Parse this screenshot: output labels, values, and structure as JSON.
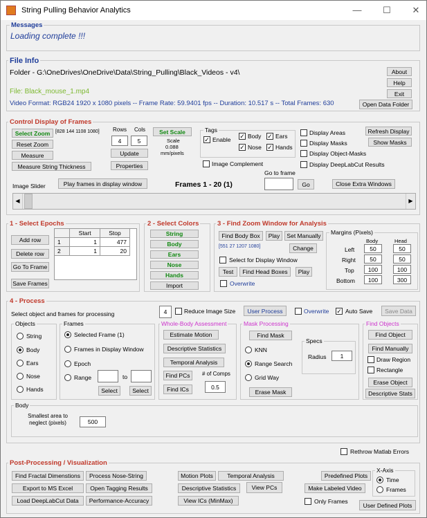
{
  "window": {
    "title": "String Pulling Behavior Analytics",
    "min": "—",
    "max": "☐",
    "close": "✕"
  },
  "messages": {
    "title": "Messages",
    "text": "Loading complete !!!"
  },
  "file_info": {
    "title": "File Info",
    "folder": "Folder - G:\\OneDrives\\OneDrive\\Data\\String_Pulling\\Black_Videos - v4\\",
    "file": "File: Black_mouse_1.mp4",
    "video_format": "Video Format: RGB24 1920 x 1080 pixels -- Frame Rate: 59.9401 fps -- Duration: 10.517 s -- Total Frames: 630",
    "about": "About",
    "help": "Help",
    "exit": "Exit",
    "open_data_folder": "Open Data Folder"
  },
  "control": {
    "title": "Control Display of Frames",
    "select_zoom": "Select Zoom",
    "zoom_coords": "[828 144 1108 1080]",
    "reset_zoom": "Reset Zoom",
    "measure": "Measure",
    "measure_string": "Measure String Thickness",
    "rows_label": "Rows",
    "cols_label": "Cols",
    "rows": "4",
    "cols": "5",
    "update": "Update",
    "properties": "Properties",
    "set_scale": "Set Scale",
    "scale_label": "Scale",
    "scale_value": "0.088",
    "scale_unit": "mm/pixels",
    "tags_label": "Tags",
    "enable": "Enable",
    "body": "Body",
    "ears": "Ears",
    "nose": "Nose",
    "hands": "Hands",
    "display_areas": "Display Areas",
    "display_masks": "Display Masks",
    "display_object_masks": "Display Object-Masks",
    "display_dlc": "Display DeepLabCut Results",
    "refresh_display": "Refresh Display",
    "show_masks": "Show Masks",
    "image_complement": "Image Complement",
    "go_to_frame": "Go to frame",
    "go": "Go",
    "close_extra": "Close Extra Windows",
    "image_slider": "Image Slider",
    "play_frames": "Play frames in display window",
    "frames_label": "Frames 1 - 20 (1)"
  },
  "epochs": {
    "title": "1 - Select Epochs",
    "add_row": "Add row",
    "delete_row": "Delete row",
    "go_to_frame": "Go To Frame",
    "save_frames": "Save Frames",
    "headers": [
      "",
      "Start",
      "Stop"
    ],
    "rows": [
      [
        "1",
        "1",
        "477"
      ],
      [
        "2",
        "1",
        "20"
      ]
    ]
  },
  "colors": {
    "title": "2 - Select Colors",
    "items": [
      "String",
      "Body",
      "Ears",
      "Nose",
      "Hands"
    ],
    "import": "Import"
  },
  "zoom_window": {
    "title": "3 - Find Zoom Window for Analysis",
    "find_body_box": "Find Body Box",
    "play": "Play",
    "set_manually": "Set Manually",
    "coords": "[551 27 1207 1080]",
    "change": "Change",
    "select_display": "Select for Display Window",
    "test": "Test",
    "find_head_boxes": "Find Head Boxes",
    "play2": "Play",
    "overwrite": "Overwrite",
    "margins_title": "Margins (Pixels)",
    "body_col": "Body",
    "head_col": "Head",
    "margin_rows": [
      {
        "label": "Left",
        "body": "50",
        "head": "50"
      },
      {
        "label": "Right",
        "body": "50",
        "head": "50"
      },
      {
        "label": "Top",
        "body": "100",
        "head": "100"
      },
      {
        "label": "Bottom",
        "body": "100",
        "head": "300"
      }
    ]
  },
  "process": {
    "title": "4 - Process",
    "instruction": "Select object and frames for processing",
    "size_value": "4",
    "reduce_image": "Reduce Image Size",
    "user_process": "User Process",
    "overwrite": "Overwrite",
    "auto_save": "Auto Save",
    "save_data": "Save Data",
    "objects_label": "Objects",
    "objects": [
      "String",
      "Body",
      "Ears",
      "Nose",
      "Hands"
    ],
    "frames_label": "Frames",
    "frame_opts": [
      "Selected Frame (1)",
      "Frames in Display Window",
      "Epoch",
      "Range"
    ],
    "to": "to",
    "select1": "Select",
    "select2": "Select",
    "wba_title": "Whole-Body Assessment",
    "estimate_motion": "Estimate Motion",
    "descriptive_stats": "Descriptive Statistics",
    "temporal_analysis": "Temporal Analysis",
    "find_pcs": "Find PCs",
    "comps_label": "# of Comps",
    "comps_value": "0.5",
    "find_ics": "Find ICs",
    "mask_title": "Mask Processing",
    "find_mask": "Find Mask",
    "knn": "KNN",
    "range_search": "Range Search",
    "grid_way": "Grid Way",
    "specs_label": "Specs",
    "radius_label": "Radius",
    "radius_value": "1",
    "erase_mask": "Erase Mask",
    "find_objects_title": "Find Objects",
    "find_object": "Find Object",
    "find_manually": "Find Manually",
    "draw_region": "Draw Region",
    "rectangle": "Rectangle",
    "erase_object": "Erase Object",
    "descriptive_stats2": "Descriptive Stats",
    "body_panel_title": "Body",
    "smallest_area": "Smallest area to neglect (pixels)",
    "smallest_value": "500"
  },
  "rethrow": "Rethrow Matlab Errors",
  "post": {
    "title": "Post-Processing / Visualization",
    "find_fractal": "Find Fractal Dimenstions",
    "process_nose": "Process Nose-String",
    "export_excel": "Export to MS Excel",
    "open_tagging": "Open Tagging Results",
    "load_dlc": "Load DeepLabCut Data",
    "perf_accuracy": "Performance-Accuracy",
    "motion_plots": "Motion Plots",
    "temporal_analysis": "Temporal Analysis",
    "descriptive_stats": "Descriptive Statistics",
    "view_pcs": "View PCs",
    "view_ics": "View ICs (MinMax)",
    "predefined_plots": "Predefined Plots",
    "make_labeled_video": "Make Labeled Video",
    "only_frames": "Only Frames",
    "user_defined_plots": "User Defined Plots",
    "xaxis_label": "X-Axis",
    "time": "Time",
    "frames": "Frames"
  },
  "colors_ui": {
    "green": "#118811",
    "blue": "#1f3d9a",
    "red": "#c0392b",
    "olive": "#7cb82f",
    "magenta": "#cc33cc"
  }
}
